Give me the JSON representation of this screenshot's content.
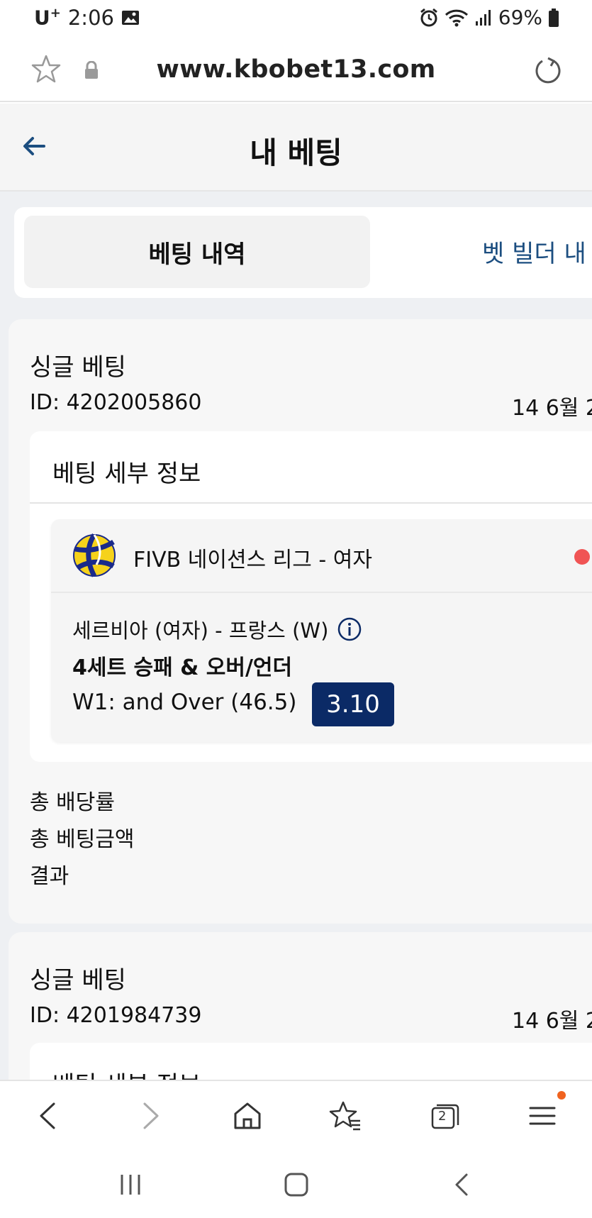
{
  "status_bar": {
    "carrier": "U",
    "carrier_sup": "+",
    "time": "2:06",
    "battery": "69%"
  },
  "browser": {
    "url": "www.kbobet13.com"
  },
  "header": {
    "title": "내 베팅"
  },
  "tabs": [
    {
      "label": "베팅 내역",
      "active": true
    },
    {
      "label": "벳 빌더 내",
      "active": false
    }
  ],
  "bets": [
    {
      "type": "싱글 베팅",
      "id": "ID: 4202005860",
      "date": "14 6월 2",
      "details_title": "베팅 세부 정보",
      "league": "FIVB 네이션스 리그 - 여자",
      "match": "세르비아 (여자) - 프랑스 (W)",
      "market": "4세트 승패 & 오버/언더",
      "pick": "W1: and Over (46.5)",
      "odds": "3.10",
      "summary": {
        "total_odds_label": "총 배당률",
        "total_stake_label": "총 베팅금액",
        "result_label": "결과"
      }
    },
    {
      "type": "싱글 베팅",
      "id": "ID: 4201984739",
      "date": "14 6월 2",
      "details_title": "베팅 세부 정보"
    }
  ],
  "colors": {
    "accent_navy": "#0b2a66",
    "tab_link_blue": "#1c4e80",
    "live_dot_red": "#f05454",
    "notif_orange": "#f0631f"
  },
  "icons": {
    "back": "arrow-left-icon",
    "star": "star-icon",
    "lock": "lock-icon",
    "reload": "reload-icon",
    "ball": "volleyball-icon",
    "info": "info-icon"
  },
  "bottom_nav": {
    "tab_count": "2"
  }
}
